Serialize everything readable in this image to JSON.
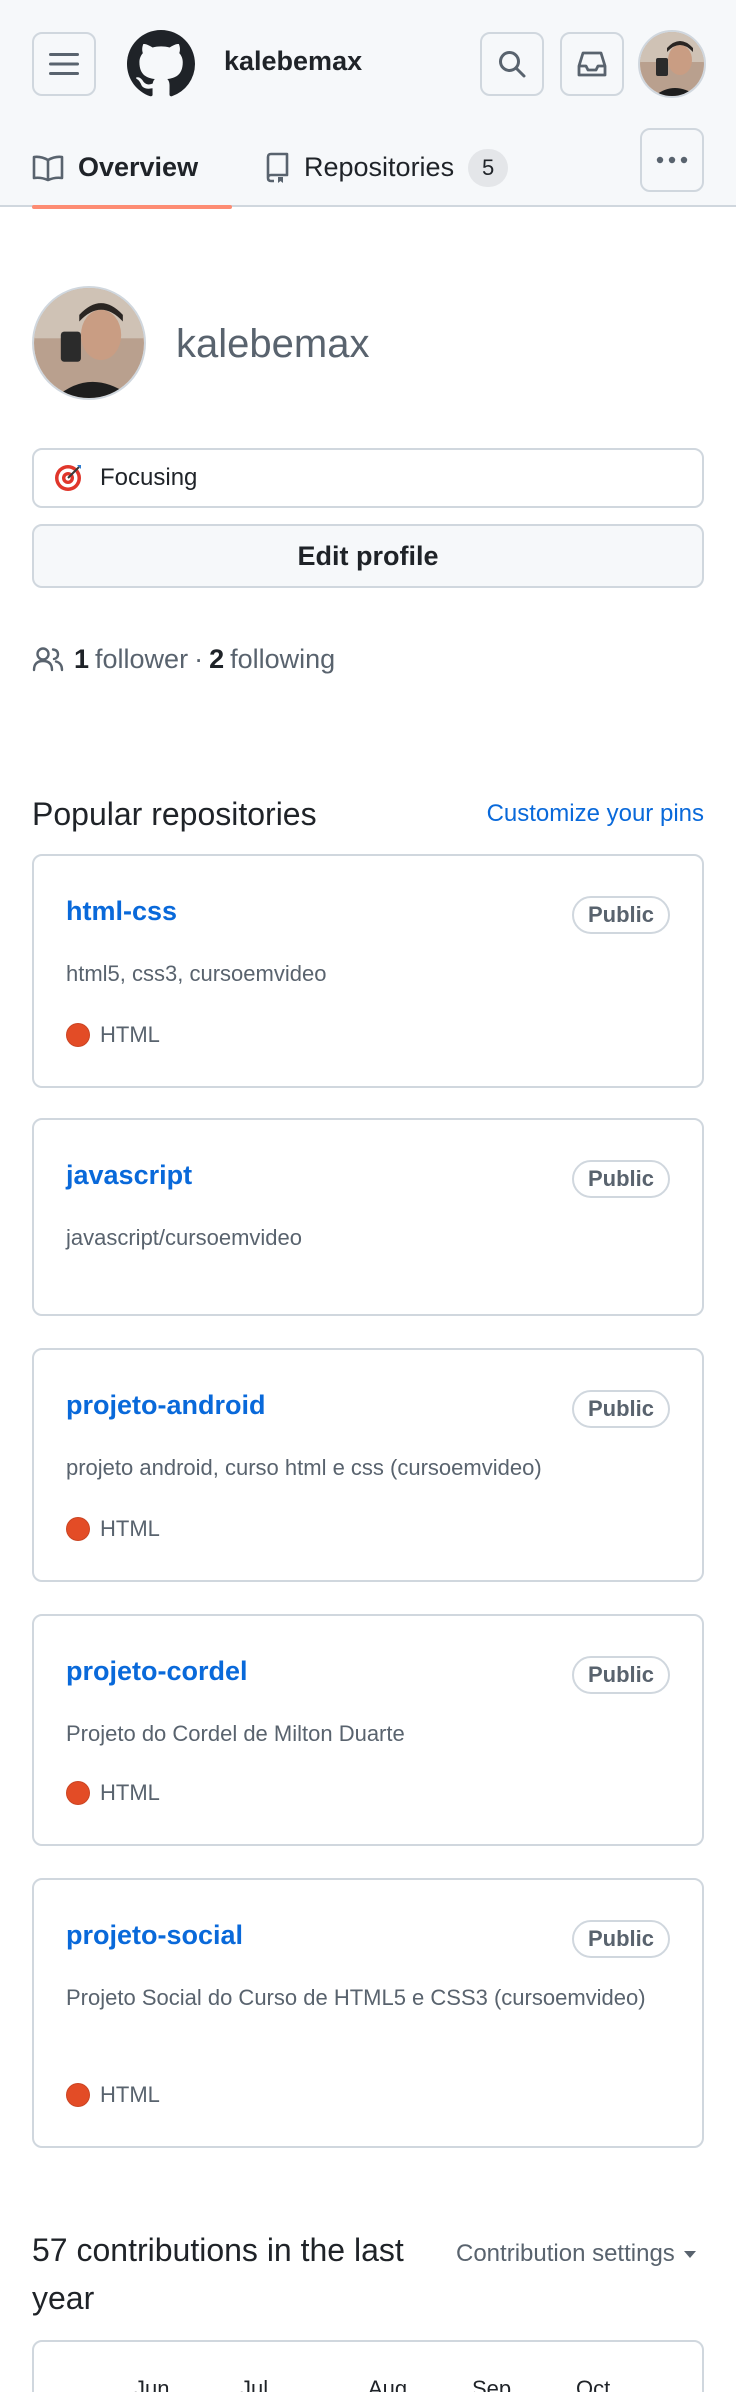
{
  "header": {
    "username": "kalebemax",
    "tabs": [
      {
        "label": "Overview"
      },
      {
        "label": "Repositories",
        "count": "5"
      }
    ]
  },
  "profile": {
    "name": "kalebemax",
    "status": "Focusing",
    "edit_label": "Edit profile",
    "followers_count": "1",
    "followers_label": "follower",
    "separator": "·",
    "following_count": "2",
    "following_label": "following"
  },
  "pinned": {
    "title": "Popular repositories",
    "customize_label": "Customize your pins",
    "repos": [
      {
        "name": "html-css",
        "visibility": "Public",
        "description": "html5, css3, cursoemvideo",
        "language": "HTML",
        "language_color": "#e34c26"
      },
      {
        "name": "javascript",
        "visibility": "Public",
        "description": "javascript/cursoemvideo",
        "language": "",
        "language_color": ""
      },
      {
        "name": "projeto-android",
        "visibility": "Public",
        "description": "projeto android, curso html e css (cursoemvideo)",
        "language": "HTML",
        "language_color": "#e34c26"
      },
      {
        "name": "projeto-cordel",
        "visibility": "Public",
        "description": "Projeto do Cordel de Milton Duarte",
        "language": "HTML",
        "language_color": "#e34c26"
      },
      {
        "name": "projeto-social",
        "visibility": "Public",
        "description": "Projeto Social do Curso de HTML5 e CSS3 (cursoemvideo)",
        "language": "HTML",
        "language_color": "#e34c26"
      }
    ]
  },
  "contributions": {
    "title": "57 contributions in the last year",
    "settings_label": "Contribution settings",
    "months": [
      "Jun",
      "Jul",
      "Aug",
      "Sep",
      "Oct"
    ]
  },
  "colors": {
    "accent_link": "#0969da",
    "tab_underline": "#fd8c73",
    "border": "#d0d7de",
    "muted": "#59636e"
  }
}
